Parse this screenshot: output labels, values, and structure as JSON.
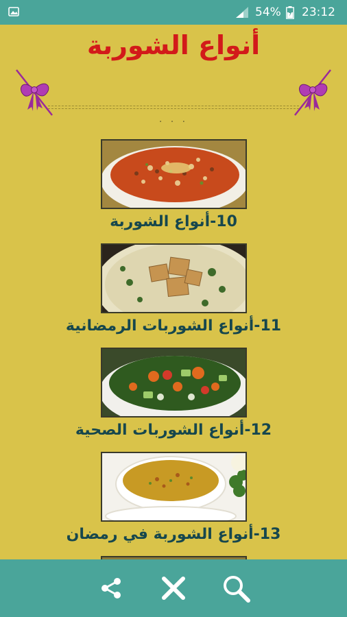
{
  "status_bar": {
    "battery_percent": "54%",
    "time": "23:12"
  },
  "header": {
    "title": "أنواع الشوربة"
  },
  "list": {
    "items": [
      {
        "label": "10-أنواع الشوربة",
        "image": "minestrone-soup-bowl"
      },
      {
        "label": "11-أنواع الشوربات الرمضانية",
        "image": "cream-soup-with-croutons"
      },
      {
        "label": "12-أنواع الشوربات الصحية",
        "image": "vegetable-soup-bowl"
      },
      {
        "label": "13-أنواع الشوربة في رمضان",
        "image": "lentil-soup-bowl"
      }
    ]
  },
  "bottom_bar": {
    "icons": [
      "share-icon",
      "close-icon",
      "search-icon"
    ]
  },
  "colors": {
    "background": "#d9c34a",
    "bars": "#4aa59a",
    "title": "#d21a1a",
    "caption": "#17474d"
  }
}
